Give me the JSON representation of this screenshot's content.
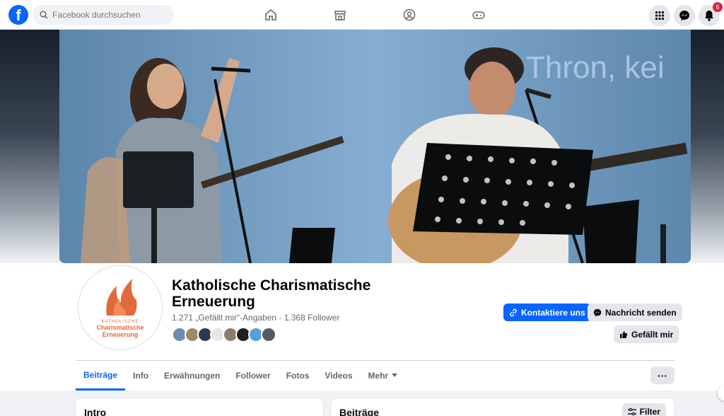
{
  "topbar": {
    "logo": "f",
    "search_placeholder": "Facebook durchsuchen",
    "nav_icons": [
      "home-icon",
      "marketplace-icon",
      "groups-icon",
      "gaming-icon"
    ],
    "notifications_count": "6"
  },
  "page": {
    "name": "Katholische Charismatische Erneuerung",
    "stats": "1.271 „Gefällt mir“-Angaben · 1.368 Follower",
    "avatar_small": "KATHOLISCHE",
    "avatar_line1": "Charismatische",
    "avatar_line2": "Erneuerung"
  },
  "cover": {
    "background_text": "Thron, kei"
  },
  "actions": {
    "contact": "Kontaktiere uns",
    "message": "Nachricht senden",
    "like": "Gefällt mir"
  },
  "tabs": [
    {
      "label": "Beiträge"
    },
    {
      "label": "Info"
    },
    {
      "label": "Erwähnungen"
    },
    {
      "label": "Follower"
    },
    {
      "label": "Fotos"
    },
    {
      "label": "Videos"
    },
    {
      "label": "Mehr"
    }
  ],
  "more_button": "···",
  "cards": {
    "intro": "Intro",
    "posts": "Beiträge",
    "filter": "Filter"
  },
  "colors": {
    "accent": "#0866ff",
    "brand_orange": "#e06a3b"
  }
}
